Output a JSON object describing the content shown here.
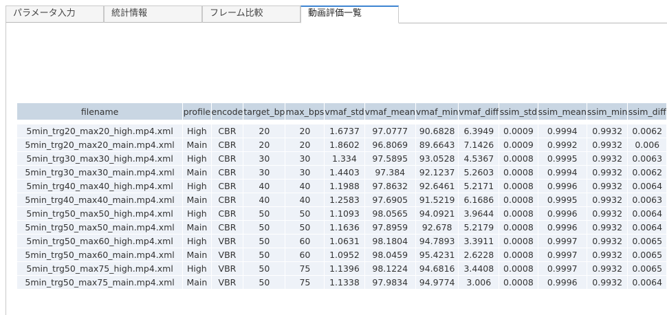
{
  "tabs": [
    {
      "label": "パラメータ入力",
      "active": false
    },
    {
      "label": "統計情報",
      "active": false
    },
    {
      "label": "フレーム比較",
      "active": false
    },
    {
      "label": "動画評価一覧",
      "active": true
    }
  ],
  "colors": {
    "accent": "#3d84d1",
    "header_bg": "#c9d6e3",
    "row_bg": "#edf1f7"
  },
  "table": {
    "headers": [
      "filename",
      "profile",
      "encode",
      "target_bp",
      "max_bps",
      "vmaf_std",
      "vmaf_mean",
      "vmaf_min",
      "vmaf_diff",
      "ssim_std",
      "ssim_mean",
      "ssim_min",
      "ssim_diff"
    ],
    "rows": [
      [
        "5min_trg20_max20_high.mp4.xml",
        "High",
        "CBR",
        "20",
        "20",
        "1.6737",
        "97.0777",
        "90.6828",
        "6.3949",
        "0.0009",
        "0.9994",
        "0.9932",
        "0.0062"
      ],
      [
        "5min_trg20_max20_main.mp4.xml",
        "Main",
        "CBR",
        "20",
        "20",
        "1.8602",
        "96.8069",
        "89.6643",
        "7.1426",
        "0.0009",
        "0.9992",
        "0.9932",
        "0.006"
      ],
      [
        "5min_trg30_max30_high.mp4.xml",
        "High",
        "CBR",
        "30",
        "30",
        "1.334",
        "97.5895",
        "93.0528",
        "4.5367",
        "0.0008",
        "0.9995",
        "0.9932",
        "0.0063"
      ],
      [
        "5min_trg30_max30_main.mp4.xml",
        "Main",
        "CBR",
        "30",
        "30",
        "1.4403",
        "97.384",
        "92.1237",
        "5.2603",
        "0.0008",
        "0.9994",
        "0.9932",
        "0.0062"
      ],
      [
        "5min_trg40_max40_high.mp4.xml",
        "High",
        "CBR",
        "40",
        "40",
        "1.1988",
        "97.8632",
        "92.6461",
        "5.2171",
        "0.0008",
        "0.9996",
        "0.9932",
        "0.0064"
      ],
      [
        "5min_trg40_max40_main.mp4.xml",
        "Main",
        "CBR",
        "40",
        "40",
        "1.2583",
        "97.6905",
        "91.5219",
        "6.1686",
        "0.0008",
        "0.9995",
        "0.9932",
        "0.0063"
      ],
      [
        "5min_trg50_max50_high.mp4.xml",
        "High",
        "CBR",
        "50",
        "50",
        "1.1093",
        "98.0565",
        "94.0921",
        "3.9644",
        "0.0008",
        "0.9996",
        "0.9932",
        "0.0064"
      ],
      [
        "5min_trg50_max50_main.mp4.xml",
        "Main",
        "CBR",
        "50",
        "50",
        "1.1636",
        "97.8959",
        "92.678",
        "5.2179",
        "0.0008",
        "0.9996",
        "0.9932",
        "0.0064"
      ],
      [
        "5min_trg50_max60_high.mp4.xml",
        "High",
        "VBR",
        "50",
        "60",
        "1.0631",
        "98.1804",
        "94.7893",
        "3.3911",
        "0.0008",
        "0.9997",
        "0.9932",
        "0.0065"
      ],
      [
        "5min_trg50_max60_main.mp4.xml",
        "Main",
        "VBR",
        "50",
        "60",
        "1.0952",
        "98.0459",
        "95.4231",
        "2.6228",
        "0.0008",
        "0.9997",
        "0.9932",
        "0.0065"
      ],
      [
        "5min_trg50_max75_high.mp4.xml",
        "High",
        "VBR",
        "50",
        "75",
        "1.1396",
        "98.1224",
        "94.6816",
        "3.4408",
        "0.0008",
        "0.9997",
        "0.9932",
        "0.0065"
      ],
      [
        "5min_trg50_max75_main.mp4.xml",
        "Main",
        "VBR",
        "50",
        "75",
        "1.1338",
        "97.9834",
        "94.9774",
        "3.006",
        "0.0008",
        "0.9996",
        "0.9932",
        "0.0064"
      ]
    ]
  }
}
